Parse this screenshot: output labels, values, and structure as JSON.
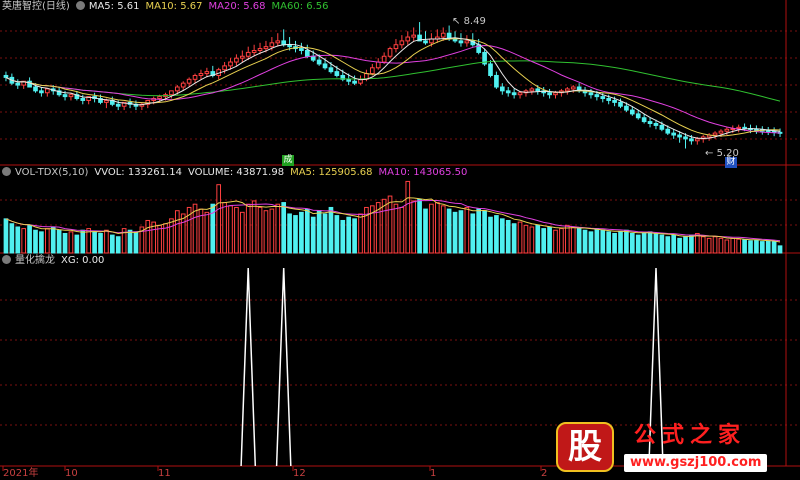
{
  "legends": {
    "price": {
      "title": "英唐智控(日线)",
      "items": [
        {
          "label": "MA5: 5.61",
          "color": "#e8e8e8"
        },
        {
          "label": "MA10: 5.67",
          "color": "#e8d050"
        },
        {
          "label": "MA20: 5.68",
          "color": "#e040e0"
        },
        {
          "label": "MA60: 6.56",
          "color": "#30c030"
        }
      ]
    },
    "volume": {
      "title": "VOL-TDX(5,10)",
      "items": [
        {
          "label": "VVOL: 133261.14",
          "color": "#e8e8e8"
        },
        {
          "label": "VOLUME: 43871.98",
          "color": "#e8e8e8"
        },
        {
          "label": "MA5: 125905.68",
          "color": "#e8d050"
        },
        {
          "label": "MA10: 143065.50",
          "color": "#e040e0"
        }
      ]
    },
    "indicator": {
      "title": "量化擒龙",
      "items": [
        {
          "label": "XG: 0.00",
          "color": "#e8e8e8"
        }
      ]
    }
  },
  "annotations": {
    "high_label": "8.49",
    "low_label": "5.20",
    "badge_a": "成",
    "badge_b": "财"
  },
  "date_axis": [
    "2021年",
    "10",
    "11",
    "12",
    "1",
    "2"
  ],
  "watermark": {
    "logo_char": "股",
    "name": "公式之家",
    "url": "www.gszj100.com"
  },
  "colors": {
    "up": "#ff4040",
    "down": "#50f0f0",
    "ma5": "#e8e8e8",
    "ma10": "#e8d050",
    "ma20": "#e040e0",
    "ma60": "#30c030",
    "grid": "#7a1010",
    "signal": "#ffffff"
  },
  "chart_data": [
    {
      "type": "candlestick",
      "title": "英唐智控(日线)",
      "ylim": [
        4.9,
        8.7
      ],
      "x": [
        1,
        2,
        3,
        4,
        5,
        6,
        7,
        8,
        9,
        10,
        11,
        12,
        13,
        14,
        15,
        16,
        17,
        18,
        19,
        20,
        21,
        22,
        23,
        24,
        25,
        26,
        27,
        28,
        29,
        30,
        31,
        32,
        33,
        34,
        35,
        36,
        37,
        38,
        39,
        40,
        41,
        42,
        43,
        44,
        45,
        46,
        47,
        48,
        49,
        50,
        51,
        52,
        53,
        54,
        55,
        56,
        57,
        58,
        59,
        60,
        61,
        62,
        63,
        64,
        65,
        66,
        67,
        68,
        69,
        70,
        71,
        72,
        73,
        74,
        75,
        76,
        77,
        78,
        79,
        80,
        81,
        82,
        83,
        84,
        85,
        86,
        87,
        88,
        89,
        90,
        91,
        92,
        93,
        94,
        95,
        96,
        97,
        98,
        99,
        100,
        101,
        102,
        103,
        104,
        105,
        106,
        107,
        108,
        109,
        110,
        111,
        112,
        113,
        114,
        115,
        116,
        117,
        118,
        119,
        120,
        121,
        122,
        123,
        124,
        125,
        126,
        127,
        128,
        129,
        130,
        131,
        132
      ],
      "open": [
        7.1,
        7.05,
        6.9,
        6.85,
        6.95,
        6.8,
        6.7,
        6.65,
        6.75,
        6.7,
        6.6,
        6.55,
        6.6,
        6.5,
        6.45,
        6.55,
        6.5,
        6.4,
        6.45,
        6.35,
        6.3,
        6.4,
        6.35,
        6.3,
        6.35,
        6.45,
        6.5,
        6.55,
        6.6,
        6.7,
        6.8,
        6.9,
        7.0,
        7.1,
        7.15,
        7.2,
        7.1,
        7.25,
        7.35,
        7.45,
        7.55,
        7.6,
        7.7,
        7.75,
        7.8,
        7.85,
        7.95,
        8.0,
        7.9,
        7.85,
        7.8,
        7.75,
        7.6,
        7.5,
        7.4,
        7.3,
        7.2,
        7.1,
        7.0,
        6.95,
        6.9,
        7.0,
        7.15,
        7.3,
        7.45,
        7.6,
        7.8,
        7.9,
        8.0,
        8.1,
        8.15,
        8.0,
        7.95,
        8.05,
        8.1,
        8.2,
        8.05,
        8.0,
        7.95,
        8.0,
        7.9,
        7.7,
        7.4,
        7.1,
        6.8,
        6.7,
        6.65,
        6.6,
        6.65,
        6.7,
        6.75,
        6.7,
        6.65,
        6.6,
        6.65,
        6.7,
        6.75,
        6.8,
        6.7,
        6.65,
        6.6,
        6.55,
        6.5,
        6.45,
        6.4,
        6.3,
        6.2,
        6.1,
        6.0,
        5.9,
        5.85,
        5.8,
        5.7,
        5.6,
        5.55,
        5.5,
        5.45,
        5.4,
        5.45,
        5.5,
        5.55,
        5.6,
        5.65,
        5.7,
        5.72,
        5.75,
        5.72,
        5.7,
        5.68,
        5.66,
        5.65,
        5.62
      ],
      "high": [
        7.2,
        7.15,
        7.0,
        6.95,
        7.05,
        6.9,
        6.8,
        6.75,
        6.85,
        6.8,
        6.7,
        6.65,
        6.7,
        6.6,
        6.55,
        6.65,
        6.6,
        6.5,
        6.55,
        6.45,
        6.4,
        6.5,
        6.45,
        6.4,
        6.45,
        6.55,
        6.6,
        6.65,
        6.7,
        6.85,
        6.95,
        7.05,
        7.15,
        7.25,
        7.3,
        7.35,
        7.3,
        7.45,
        7.55,
        7.65,
        7.75,
        7.85,
        7.9,
        7.95,
        8.0,
        8.1,
        8.2,
        8.3,
        8.1,
        8.0,
        7.95,
        7.9,
        7.75,
        7.65,
        7.55,
        7.45,
        7.35,
        7.25,
        7.15,
        7.1,
        7.1,
        7.25,
        7.4,
        7.55,
        7.7,
        7.85,
        8.05,
        8.15,
        8.25,
        8.35,
        8.49,
        8.25,
        8.2,
        8.3,
        8.35,
        8.4,
        8.25,
        8.2,
        8.15,
        8.2,
        8.05,
        7.8,
        7.5,
        7.2,
        6.9,
        6.8,
        6.75,
        6.7,
        6.75,
        6.8,
        6.85,
        6.8,
        6.75,
        6.7,
        6.75,
        6.8,
        6.85,
        6.9,
        6.8,
        6.75,
        6.7,
        6.65,
        6.6,
        6.55,
        6.5,
        6.4,
        6.3,
        6.2,
        6.1,
        6.0,
        5.95,
        5.9,
        5.8,
        5.7,
        5.65,
        5.6,
        5.55,
        5.5,
        5.55,
        5.6,
        5.65,
        5.7,
        5.75,
        5.8,
        5.82,
        5.85,
        5.82,
        5.8,
        5.78,
        5.76,
        5.75,
        5.72
      ],
      "low": [
        6.95,
        6.85,
        6.75,
        6.75,
        6.8,
        6.65,
        6.55,
        6.55,
        6.6,
        6.55,
        6.45,
        6.45,
        6.45,
        6.35,
        6.35,
        6.4,
        6.35,
        6.25,
        6.3,
        6.2,
        6.2,
        6.25,
        6.2,
        6.2,
        6.25,
        6.35,
        6.4,
        6.45,
        6.5,
        6.6,
        6.7,
        6.8,
        6.9,
        7.0,
        7.05,
        7.05,
        7.0,
        7.15,
        7.25,
        7.35,
        7.45,
        7.5,
        7.6,
        7.65,
        7.7,
        7.75,
        7.85,
        7.85,
        7.75,
        7.7,
        7.65,
        7.55,
        7.45,
        7.35,
        7.25,
        7.15,
        7.05,
        6.95,
        6.85,
        6.85,
        6.85,
        6.95,
        7.1,
        7.25,
        7.4,
        7.55,
        7.7,
        7.8,
        7.9,
        8.0,
        8.0,
        7.9,
        7.85,
        7.95,
        8.0,
        8.0,
        7.95,
        7.85,
        7.85,
        7.85,
        7.65,
        7.35,
        7.05,
        6.75,
        6.6,
        6.55,
        6.5,
        6.5,
        6.55,
        6.6,
        6.6,
        6.55,
        6.5,
        6.5,
        6.55,
        6.6,
        6.65,
        6.65,
        6.55,
        6.5,
        6.45,
        6.4,
        6.35,
        6.3,
        6.25,
        6.15,
        6.05,
        5.95,
        5.85,
        5.75,
        5.7,
        5.65,
        5.55,
        5.45,
        5.35,
        5.2,
        5.3,
        5.3,
        5.35,
        5.4,
        5.45,
        5.5,
        5.55,
        5.6,
        5.62,
        5.65,
        5.6,
        5.58,
        5.56,
        5.55,
        5.52,
        5.5
      ],
      "close": [
        7.05,
        6.9,
        6.85,
        6.95,
        6.8,
        6.7,
        6.65,
        6.75,
        6.7,
        6.6,
        6.55,
        6.6,
        6.5,
        6.45,
        6.55,
        6.5,
        6.4,
        6.45,
        6.35,
        6.3,
        6.4,
        6.35,
        6.3,
        6.35,
        6.45,
        6.5,
        6.55,
        6.6,
        6.7,
        6.8,
        6.9,
        7.0,
        7.1,
        7.15,
        7.2,
        7.1,
        7.25,
        7.35,
        7.45,
        7.55,
        7.6,
        7.7,
        7.75,
        7.8,
        7.85,
        7.95,
        8.0,
        7.9,
        7.85,
        7.8,
        7.75,
        7.6,
        7.5,
        7.4,
        7.3,
        7.2,
        7.1,
        7.0,
        6.95,
        6.9,
        7.0,
        7.15,
        7.3,
        7.45,
        7.6,
        7.8,
        7.9,
        8.0,
        8.1,
        8.15,
        8.0,
        7.95,
        8.05,
        8.1,
        8.2,
        8.05,
        8.0,
        7.95,
        8.0,
        7.9,
        7.7,
        7.4,
        7.1,
        6.8,
        6.7,
        6.65,
        6.6,
        6.65,
        6.7,
        6.75,
        6.7,
        6.65,
        6.6,
        6.65,
        6.7,
        6.75,
        6.8,
        6.7,
        6.65,
        6.6,
        6.55,
        6.5,
        6.45,
        6.4,
        6.3,
        6.2,
        6.1,
        6.0,
        5.9,
        5.85,
        5.8,
        5.7,
        5.6,
        5.55,
        5.5,
        5.45,
        5.4,
        5.45,
        5.5,
        5.55,
        5.6,
        5.65,
        5.7,
        5.72,
        5.75,
        5.72,
        5.7,
        5.68,
        5.66,
        5.65,
        5.62,
        5.61
      ]
    },
    {
      "type": "bar",
      "title": "VOL-TDX(5,10)",
      "x": [
        1,
        2,
        3,
        4,
        5,
        6,
        7,
        8,
        9,
        10,
        11,
        12,
        13,
        14,
        15,
        16,
        17,
        18,
        19,
        20,
        21,
        22,
        23,
        24,
        25,
        26,
        27,
        28,
        29,
        30,
        31,
        32,
        33,
        34,
        35,
        36,
        37,
        38,
        39,
        40,
        41,
        42,
        43,
        44,
        45,
        46,
        47,
        48,
        49,
        50,
        51,
        52,
        53,
        54,
        55,
        56,
        57,
        58,
        59,
        60,
        61,
        62,
        63,
        64,
        65,
        66,
        67,
        68,
        69,
        70,
        71,
        72,
        73,
        74,
        75,
        76,
        77,
        78,
        79,
        80,
        81,
        82,
        83,
        84,
        85,
        86,
        87,
        88,
        89,
        90,
        91,
        92,
        93,
        94,
        95,
        96,
        97,
        98,
        99,
        100,
        101,
        102,
        103,
        104,
        105,
        106,
        107,
        108,
        109,
        110,
        111,
        112,
        113,
        114,
        115,
        116,
        117,
        118,
        119,
        120,
        121,
        122,
        123,
        124,
        125,
        126,
        127,
        128,
        129,
        130,
        131,
        132
      ],
      "values": [
        210000,
        180000,
        160000,
        150000,
        170000,
        140000,
        130000,
        150000,
        160000,
        140000,
        120000,
        130000,
        110000,
        140000,
        150000,
        130000,
        120000,
        140000,
        110000,
        100000,
        150000,
        140000,
        130000,
        160000,
        200000,
        190000,
        170000,
        180000,
        210000,
        260000,
        240000,
        280000,
        300000,
        270000,
        250000,
        300000,
        420000,
        310000,
        290000,
        280000,
        250000,
        300000,
        320000,
        280000,
        260000,
        270000,
        300000,
        310000,
        240000,
        230000,
        250000,
        270000,
        220000,
        260000,
        240000,
        280000,
        230000,
        200000,
        220000,
        210000,
        240000,
        280000,
        290000,
        310000,
        330000,
        350000,
        300000,
        280000,
        440000,
        320000,
        330000,
        270000,
        300000,
        310000,
        290000,
        270000,
        250000,
        260000,
        280000,
        240000,
        270000,
        260000,
        220000,
        230000,
        210000,
        200000,
        180000,
        190000,
        170000,
        160000,
        170000,
        150000,
        160000,
        140000,
        150000,
        170000,
        160000,
        150000,
        140000,
        130000,
        150000,
        140000,
        130000,
        120000,
        130000,
        140000,
        120000,
        110000,
        120000,
        130000,
        120000,
        110000,
        100000,
        110000,
        90000,
        100000,
        110000,
        120000,
        100000,
        90000,
        100000,
        90000,
        80000,
        90000,
        85000,
        80000,
        75000,
        80000,
        70000,
        75000,
        70000,
        43871.98
      ],
      "ma5_last": 125905.68,
      "ma10_last": 143065.5,
      "vvol_last": 133261.14
    },
    {
      "type": "line",
      "title": "量化擒龙",
      "series": [
        {
          "name": "XG",
          "signal_x": [
            42,
            48,
            111
          ],
          "value": 1,
          "last": 0.0
        }
      ],
      "ylim": [
        0,
        1
      ]
    }
  ]
}
